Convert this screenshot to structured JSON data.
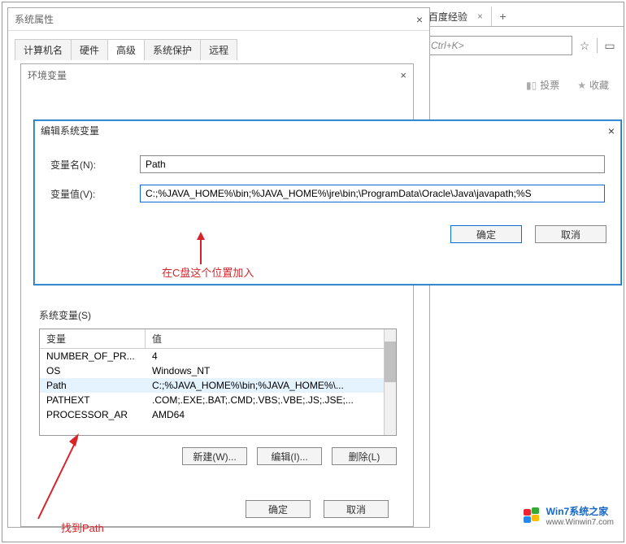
{
  "browser": {
    "tab_label": "百度经验",
    "tab_close": "×",
    "new_tab": "+",
    "url_hint": "Ctrl+K>",
    "star": "☆",
    "book": "▭",
    "vote_icon": "▮▯",
    "vote_label": "投票",
    "fav_icon": "★",
    "fav_label": "收藏"
  },
  "sys_props": {
    "title": "系统属性",
    "close": "×",
    "tabs": {
      "computer_name": "计算机名",
      "hardware": "硬件",
      "advanced": "高级",
      "protection": "系统保护",
      "remote": "远程"
    }
  },
  "env_vars": {
    "title": "环境变量",
    "close": "×",
    "sys_label": "系统变量(S)",
    "col_var": "变量",
    "col_val": "值",
    "rows": [
      {
        "var": "NUMBER_OF_PR...",
        "val": "4"
      },
      {
        "var": "OS",
        "val": "Windows_NT"
      },
      {
        "var": "Path",
        "val": "C:;%JAVA_HOME%\\bin;%JAVA_HOME%\\..."
      },
      {
        "var": "PATHEXT",
        "val": ".COM;.EXE;.BAT;.CMD;.VBS;.VBE;.JS;.JSE;..."
      },
      {
        "var": "PROCESSOR_AR",
        "val": "AMD64"
      }
    ],
    "btn_new": "新建(W)...",
    "btn_edit": "编辑(I)...",
    "btn_del": "删除(L)",
    "btn_ok": "确定",
    "btn_cancel": "取消"
  },
  "edit_dialog": {
    "title": "编辑系统变量",
    "close": "×",
    "name_label": "变量名(N):",
    "name_value": "Path",
    "value_label": "变量值(V):",
    "value_value": "C:;%JAVA_HOME%\\bin;%JAVA_HOME%\\jre\\bin;\\ProgramData\\Oracle\\Java\\javapath;%S",
    "btn_ok": "确定",
    "btn_cancel": "取消"
  },
  "annotations": {
    "a1": "在C盘这个位置加入",
    "a2": "找到Path"
  },
  "watermark": {
    "line1": "Win7系统之家",
    "line2": "www.Winwin7.com"
  }
}
